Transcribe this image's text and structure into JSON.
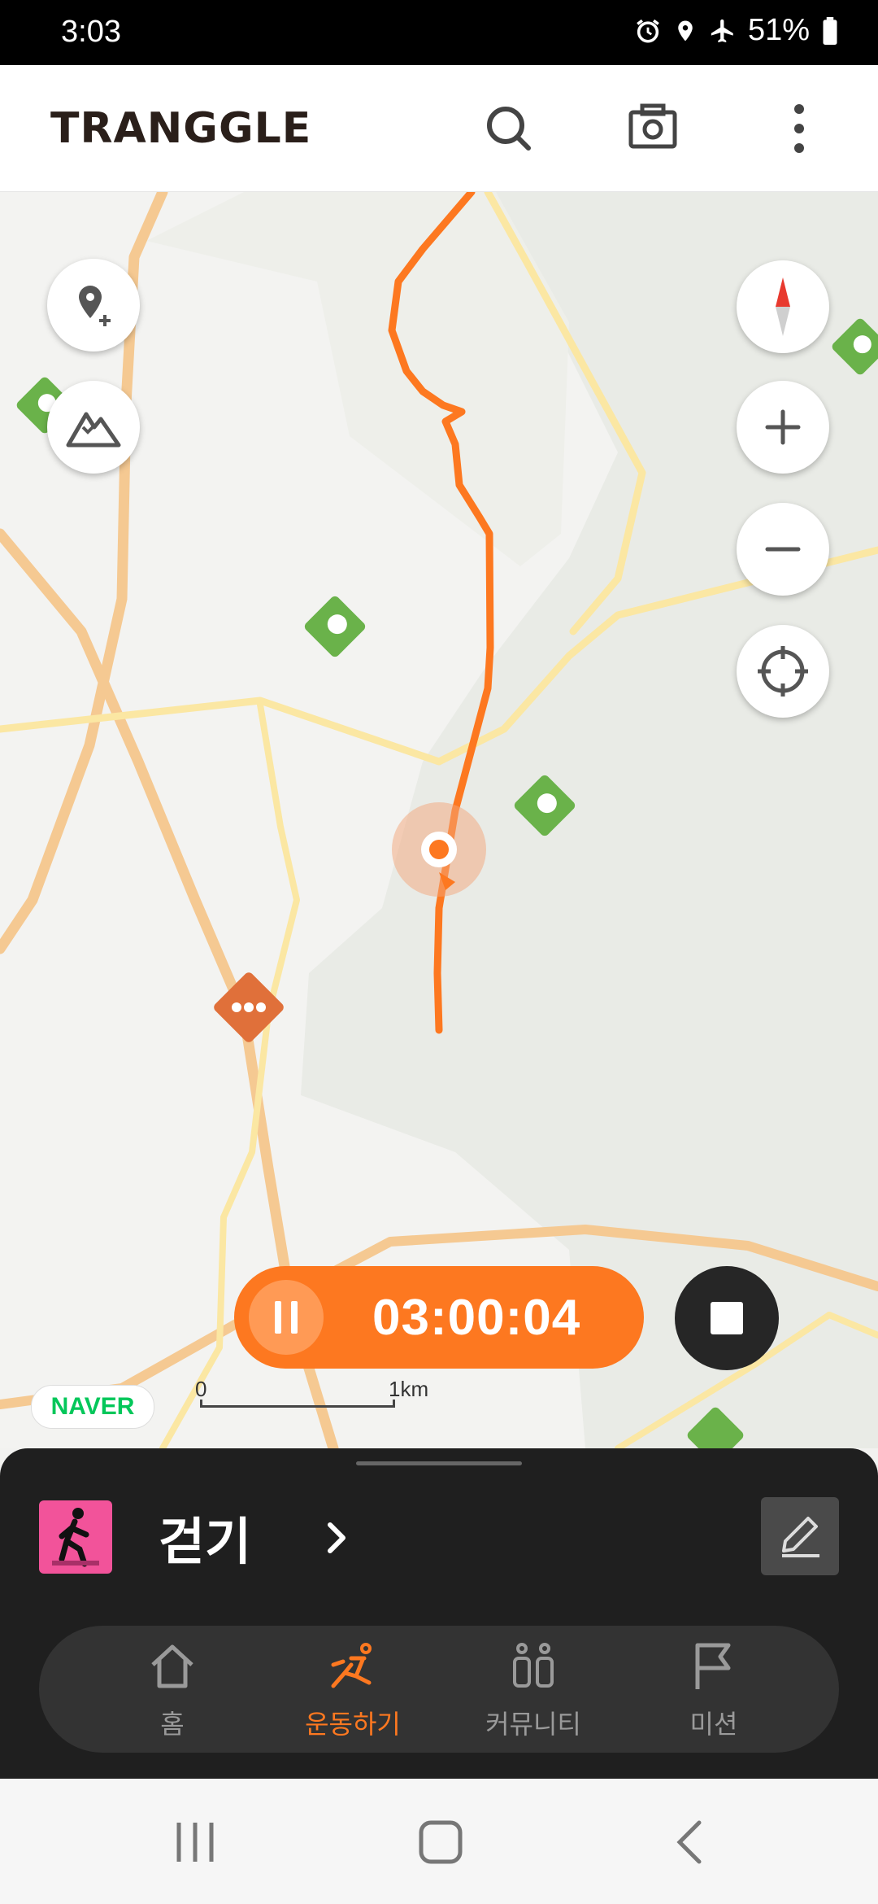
{
  "status_bar": {
    "time": "3:03",
    "battery": "51%",
    "icons": [
      "alarm-icon",
      "location-icon",
      "airplane-icon",
      "battery-icon"
    ]
  },
  "app_bar": {
    "logo": "TRANGGLE",
    "icons": [
      "search-icon",
      "camera-icon",
      "more-vert-icon"
    ]
  },
  "map": {
    "timer": "03:00:04",
    "provider": "NAVER",
    "scale": {
      "start": "0",
      "end": "1km"
    },
    "controls": [
      "add-location-icon",
      "mountain-icon",
      "compass-icon",
      "zoom-in-icon",
      "zoom-out-icon",
      "my-location-icon"
    ]
  },
  "activity": {
    "name": "걷기"
  },
  "bottom_nav": {
    "items": [
      {
        "label": "홈",
        "icon": "home-icon",
        "active": false
      },
      {
        "label": "운동하기",
        "icon": "exercise-icon",
        "active": true
      },
      {
        "label": "커뮤니티",
        "icon": "community-icon",
        "active": false
      },
      {
        "label": "미션",
        "icon": "flag-icon",
        "active": false
      }
    ]
  },
  "colors": {
    "accent": "#fd7820",
    "sheet": "#1f1f1f",
    "activity_icon": "#f2539a",
    "naver_green": "#03c75a"
  }
}
